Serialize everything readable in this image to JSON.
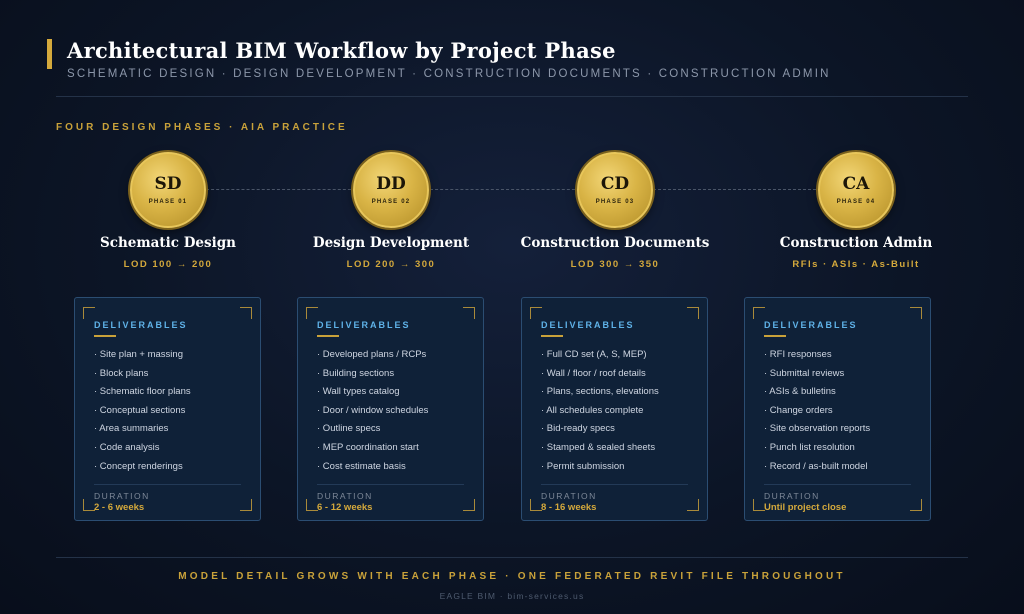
{
  "header": {
    "title": "Architectural BIM Workflow by Project Phase",
    "subtitle": "SCHEMATIC DESIGN · DESIGN DEVELOPMENT · CONSTRUCTION DOCUMENTS · CONSTRUCTION ADMIN"
  },
  "section_label": "FOUR DESIGN PHASES · AIA PRACTICE",
  "phases": [
    {
      "abbr": "SD",
      "phase_label": "PHASE 01",
      "name": "Schematic Design",
      "lod": "LOD 100 → 200",
      "deliverables_label": "DELIVERABLES",
      "items": [
        "· Site plan + massing",
        "· Block plans",
        "· Schematic floor plans",
        "· Conceptual sections",
        "· Area summaries",
        "· Code analysis",
        "· Concept renderings"
      ],
      "duration_label": "DURATION",
      "duration": "2 - 6 weeks"
    },
    {
      "abbr": "DD",
      "phase_label": "PHASE 02",
      "name": "Design Development",
      "lod": "LOD 200 → 300",
      "deliverables_label": "DELIVERABLES",
      "items": [
        "· Developed plans / RCPs",
        "· Building sections",
        "· Wall types catalog",
        "· Door / window schedules",
        "· Outline specs",
        "· MEP coordination start",
        "· Cost estimate basis"
      ],
      "duration_label": "DURATION",
      "duration": "6 - 12 weeks"
    },
    {
      "abbr": "CD",
      "phase_label": "PHASE 03",
      "name": "Construction Documents",
      "lod": "LOD 300 → 350",
      "deliverables_label": "DELIVERABLES",
      "items": [
        "· Full CD set (A, S, MEP)",
        "· Wall / floor / roof details",
        "· Plans, sections, elevations",
        "· All schedules complete",
        "· Bid-ready specs",
        "· Stamped & sealed sheets",
        "· Permit submission"
      ],
      "duration_label": "DURATION",
      "duration": "8 - 16 weeks"
    },
    {
      "abbr": "CA",
      "phase_label": "PHASE 04",
      "name": "Construction Admin",
      "lod": "RFIs · ASIs · As-Built",
      "deliverables_label": "DELIVERABLES",
      "items": [
        "· RFI responses",
        "· Submittal reviews",
        "· ASIs & bulletins",
        "· Change orders",
        "· Site observation reports",
        "· Punch list resolution",
        "· Record / as-built model"
      ],
      "duration_label": "DURATION",
      "duration": "Until project close"
    }
  ],
  "footer": {
    "tagline": "MODEL DETAIL GROWS WITH EACH PHASE · ONE FEDERATED REVIT FILE THROUGHOUT",
    "credit": "EAGLE BIM · bim-services.us"
  },
  "colors": {
    "accent_gold": "#d4a93c",
    "heading_blue": "#5fb2e8",
    "background": "#0c1526"
  }
}
